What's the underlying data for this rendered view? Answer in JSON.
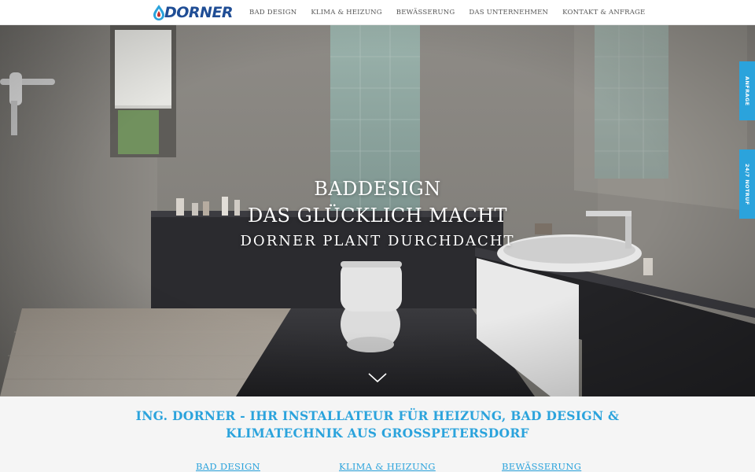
{
  "brand": {
    "logo_text": "DORNER",
    "logo_color": "#1f4d95",
    "drop_color": "#2ba3dc",
    "drop_inner_color": "#c8302b"
  },
  "nav": {
    "items": [
      {
        "label": "BAD DESIGN"
      },
      {
        "label": "KLIMA & HEIZUNG"
      },
      {
        "label": "BEWÄSSERUNG"
      },
      {
        "label": "DAS UNTERNEHMEN"
      },
      {
        "label": "KONTAKT & ANFRAGE"
      }
    ]
  },
  "hero": {
    "line1": "BADDESIGN",
    "line2": "DAS GLÜCKLICH MACHT",
    "line3": "DORNER PLANT DURCHDACHT",
    "scroll_icon": "chevron-down-icon"
  },
  "side_tabs": {
    "anfrage": "ANFRAGE",
    "notruf": "24/7 NOTRUF"
  },
  "intro": {
    "title_line1": "ING. DORNER - IHR INSTALLATEUR FÜR HEIZUNG, BAD DESIGN &",
    "title_line2": "KLIMATECHNIK AUS GROSSPETERSDORF"
  },
  "services": [
    {
      "label": "BAD DESIGN"
    },
    {
      "label": "KLIMA & HEIZUNG"
    },
    {
      "label": "BEWÄSSERUNG"
    }
  ],
  "colors": {
    "accent": "#2ba3dc",
    "nav_text": "#555555",
    "section_bg": "#f5f5f5"
  }
}
